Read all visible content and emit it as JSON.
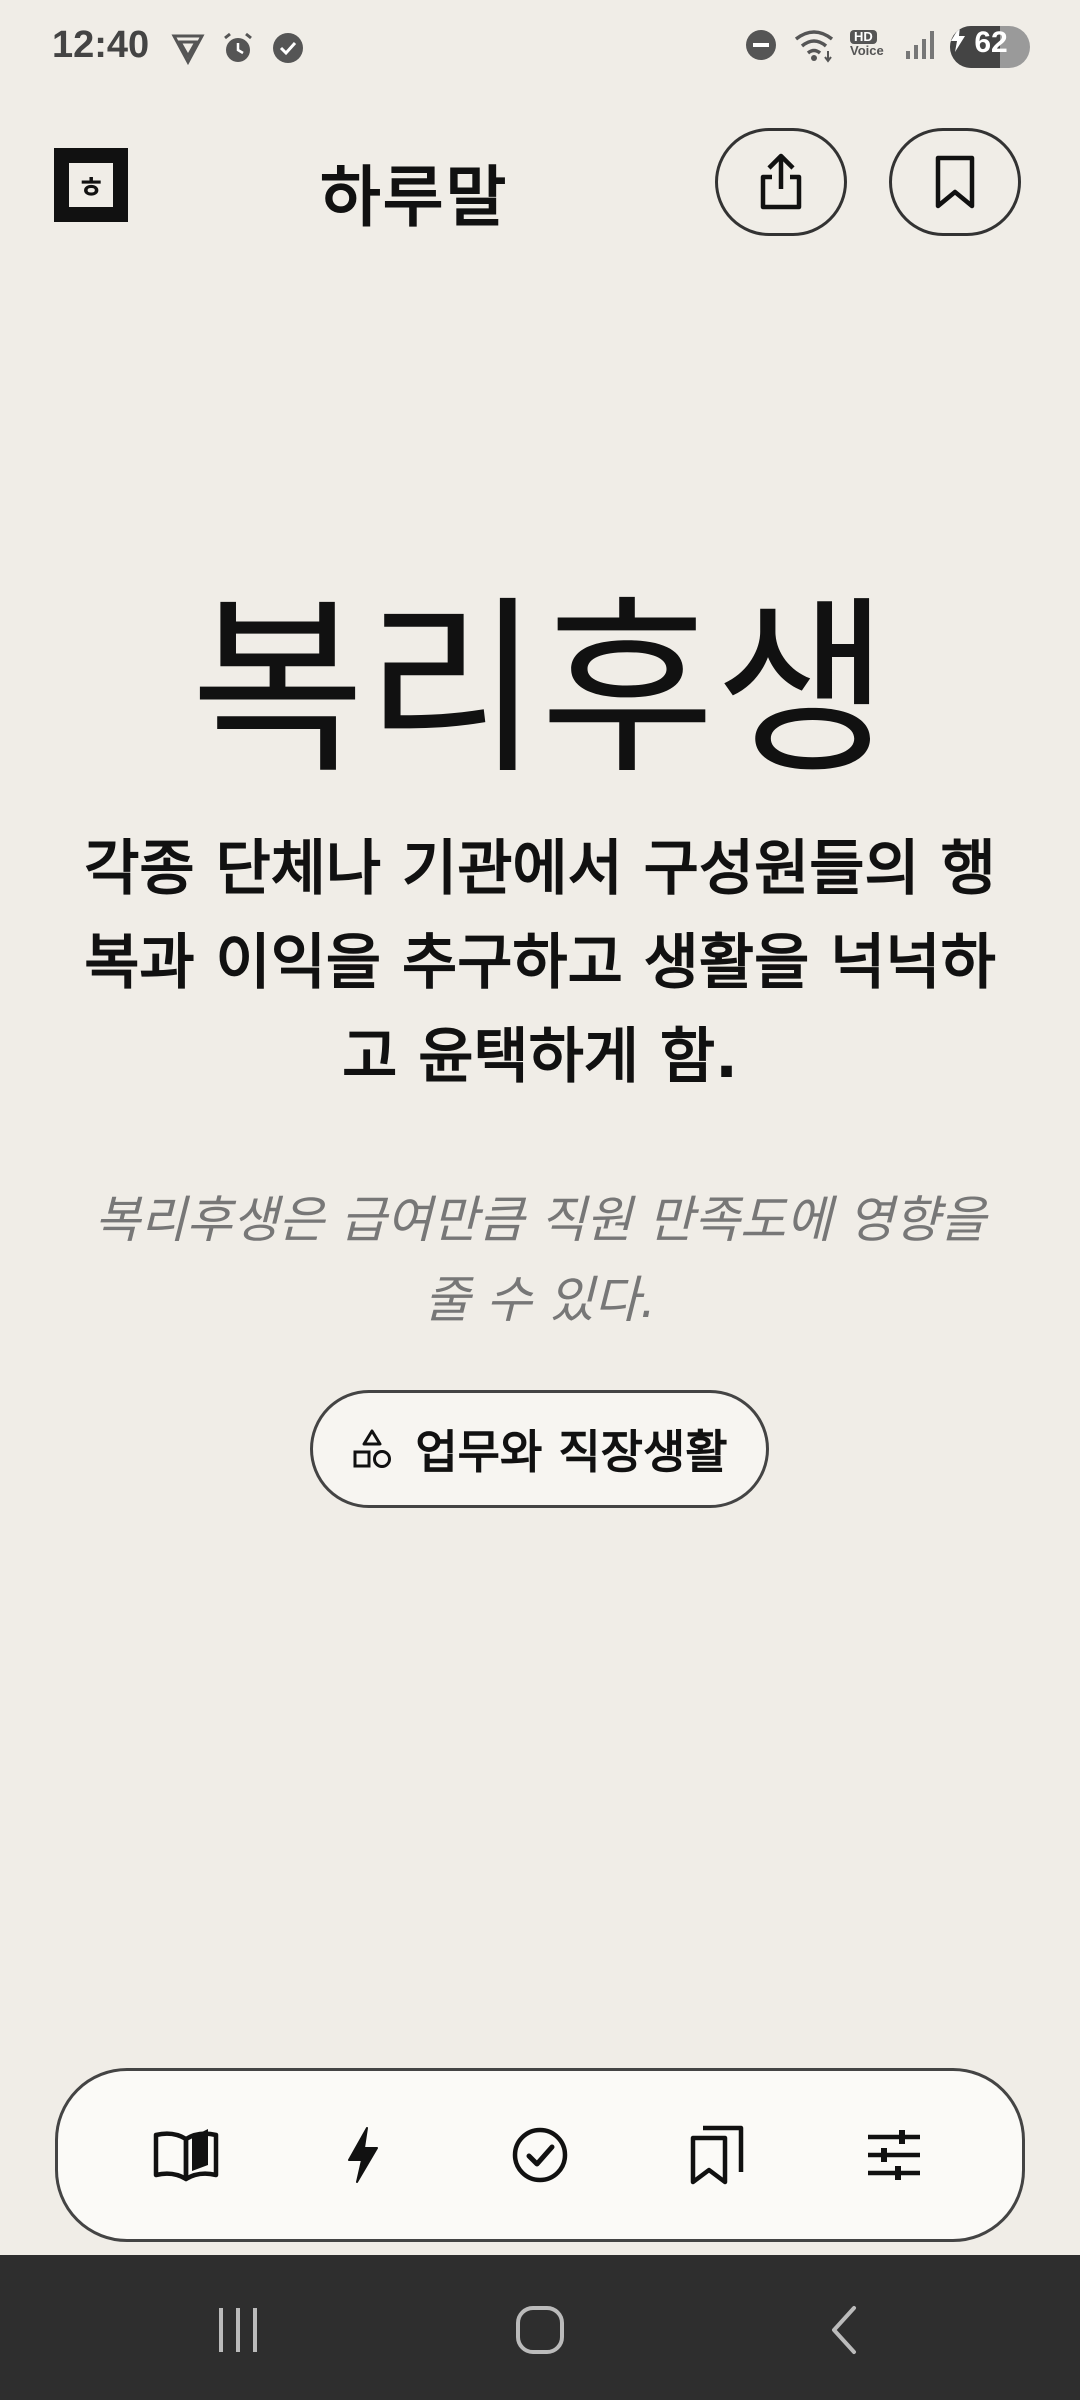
{
  "status_bar": {
    "time": "12:40",
    "battery_level": "62",
    "battery_fraction": 0.62,
    "hd_label": "HD",
    "voice_label": "Voice"
  },
  "header": {
    "logo_glyph": "ㅎ",
    "title": "하루말"
  },
  "word": {
    "term": "복리후생",
    "definition": "각종 단체나 기관에서 구성원들의 행복과 이익을 추구하고 생활을 넉넉하고 윤택하게 함.",
    "example": "복리후생은 급여만큼 직원 만족도에 영향을 줄 수 있다.",
    "category": "업무와 직장생활"
  },
  "icons": {
    "status_left": [
      "vpn-shield-icon",
      "alarm-icon",
      "check-badge-icon"
    ],
    "status_right": [
      "do-not-disturb-icon",
      "wifi-icon",
      "hd-voice-icon",
      "signal-icon",
      "battery-icon"
    ],
    "header_actions": [
      "share-icon",
      "bookmark-icon"
    ],
    "category": "shapes-icon",
    "bottom_nav": [
      "book-icon",
      "lightning-icon",
      "check-circle-icon",
      "bookmarks-icon",
      "sliders-icon"
    ],
    "system_nav": [
      "recents-icon",
      "home-icon",
      "back-icon"
    ]
  },
  "colors": {
    "background": "#f0ede7",
    "text": "#111111",
    "muted": "#777777",
    "system_nav": "#2e2e2e"
  }
}
